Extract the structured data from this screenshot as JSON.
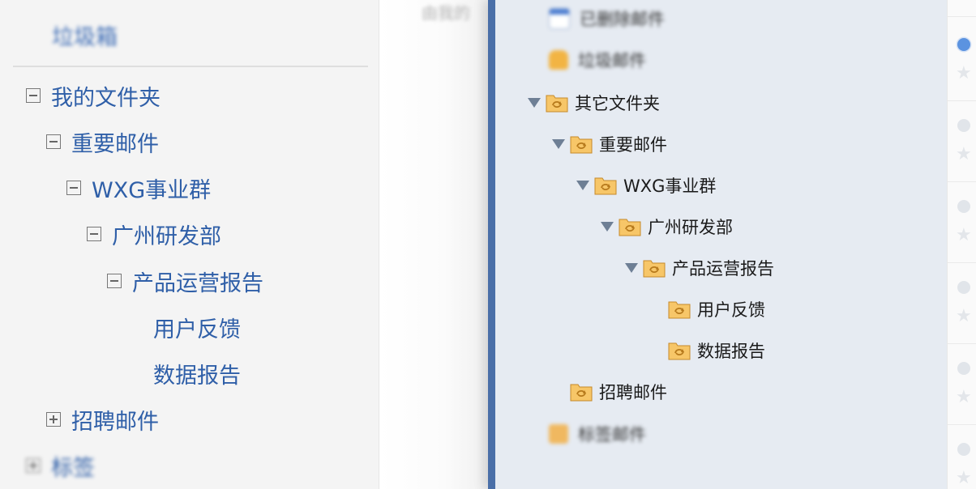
{
  "left_pane": {
    "heading": "垃圾箱",
    "tree": [
      {
        "label": "我的文件夹",
        "toggle": "minus"
      },
      {
        "label": "重要邮件",
        "toggle": "minus"
      },
      {
        "label": "WXG事业群",
        "toggle": "minus"
      },
      {
        "label": "广州研发部",
        "toggle": "minus"
      },
      {
        "label": "产品运营报告",
        "toggle": "minus"
      },
      {
        "label": "用户反馈",
        "toggle": "none"
      },
      {
        "label": "数据报告",
        "toggle": "none"
      },
      {
        "label": "招聘邮件",
        "toggle": "plus"
      },
      {
        "label": "标签",
        "toggle": "plus"
      }
    ]
  },
  "middle": {
    "partial_text": "由我的"
  },
  "right_pane": {
    "top_items": [
      {
        "label": "已删除邮件",
        "icon": "trash-can-icon"
      },
      {
        "label": "垃圾邮件",
        "icon": "junk-mail-icon"
      }
    ],
    "tree": [
      {
        "label": "其它文件夹",
        "expanded": true
      },
      {
        "label": "重要邮件",
        "expanded": true
      },
      {
        "label": "WXG事业群",
        "expanded": true
      },
      {
        "label": "广州研发部",
        "expanded": true
      },
      {
        "label": "产品运营报告",
        "expanded": true
      },
      {
        "label": "用户反馈",
        "expanded": false
      },
      {
        "label": "数据报告",
        "expanded": false
      },
      {
        "label": "招聘邮件",
        "expanded": false
      }
    ],
    "bottom_item": {
      "label": "标签邮件",
      "icon": "tag-folder-icon"
    }
  },
  "colors": {
    "left_link": "#2f5fa8",
    "right_border_accent": "#4a6fa8",
    "folder_fill": "#f7c668",
    "folder_stroke": "#c58a2a",
    "unread_dot": "#5b93e0"
  }
}
